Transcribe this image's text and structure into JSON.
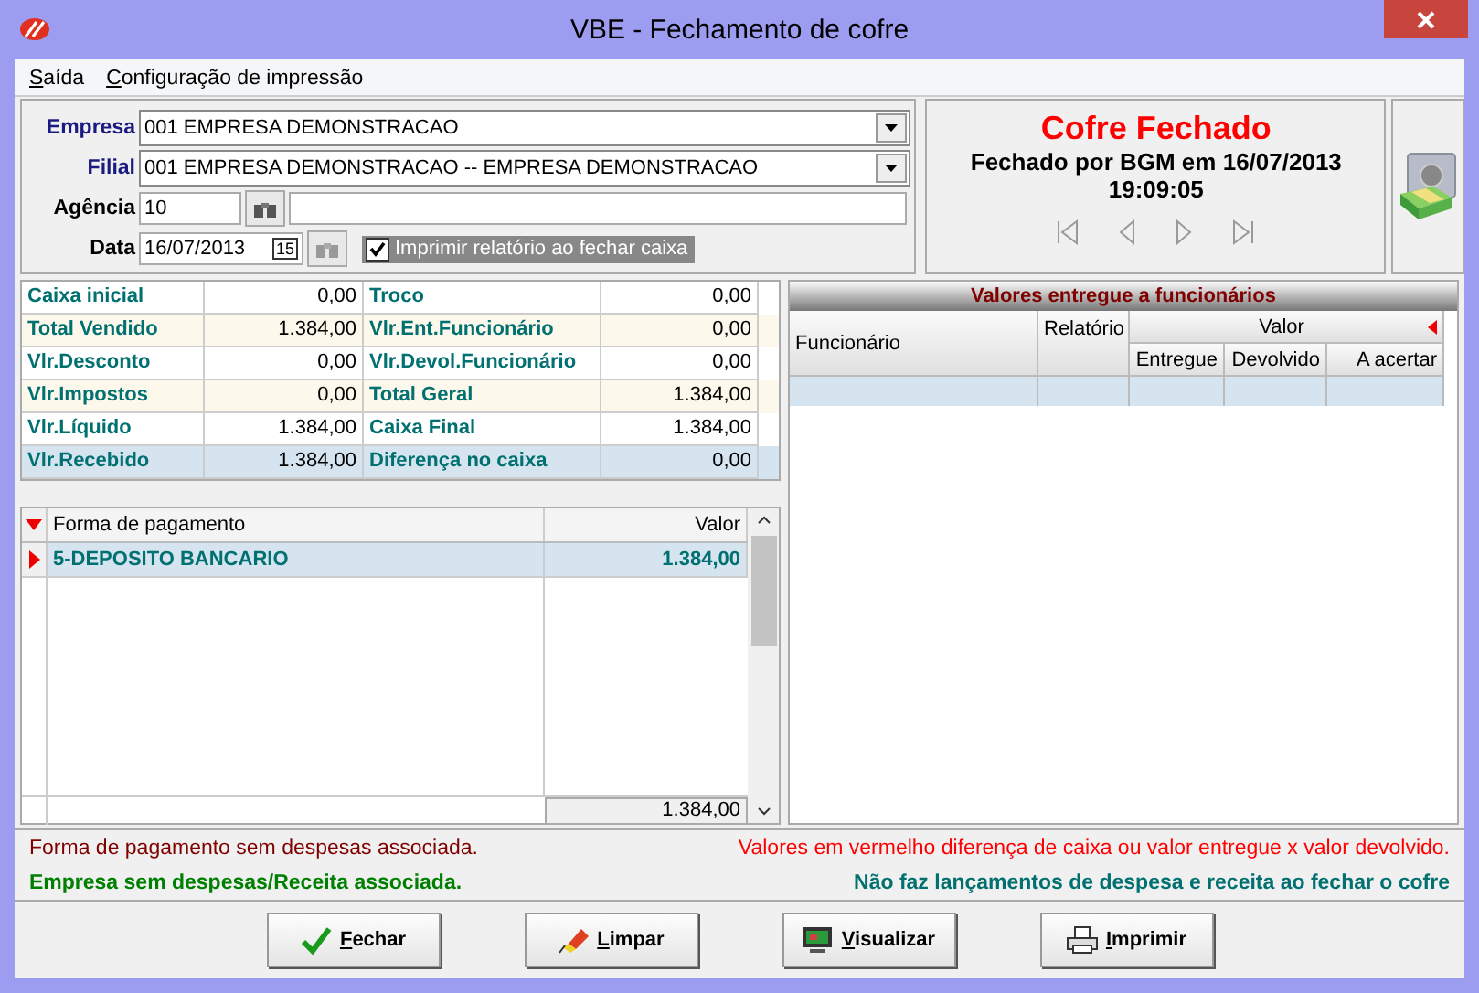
{
  "window": {
    "title": "VBE - Fechamento de cofre"
  },
  "menu": [
    {
      "label": "Saída"
    },
    {
      "label": "Configuração de impressão"
    }
  ],
  "form": {
    "empresa": {
      "label": "Empresa",
      "value": "001 EMPRESA DEMONSTRACAO"
    },
    "filial": {
      "label": "Filial",
      "value": "001 EMPRESA DEMONSTRACAO -- EMPRESA DEMONSTRACAO"
    },
    "agencia": {
      "label": "Agência",
      "value": "10"
    },
    "data": {
      "label": "Data",
      "value": "16/07/2013",
      "calendar": "15"
    },
    "print_option": {
      "label": "Imprimir relatório ao fechar caixa",
      "checked": true
    }
  },
  "status": {
    "title": "Cofre Fechado",
    "detail": "Fechado por BGM em 16/07/2013",
    "time": "19:09:05"
  },
  "summary": [
    {
      "label": "Caixa inicial",
      "value": "0,00",
      "label2": "Troco",
      "value2": "0,00",
      "selected": false
    },
    {
      "label": "Total Vendido",
      "value": "1.384,00",
      "label2": "Vlr.Ent.Funcionário",
      "value2": "0,00",
      "selected": false
    },
    {
      "label": "Vlr.Desconto",
      "value": "0,00",
      "label2": "Vlr.Devol.Funcionário",
      "value2": "0,00",
      "selected": false
    },
    {
      "label": "Vlr.Impostos",
      "value": "0,00",
      "label2": "Total Geral",
      "value2": "1.384,00",
      "selected": false
    },
    {
      "label": "Vlr.Líquido",
      "value": "1.384,00",
      "label2": "Caixa Final",
      "value2": "1.384,00",
      "selected": false
    },
    {
      "label": "Vlr.Recebido",
      "value": "1.384,00",
      "label2": "Diferença no caixa",
      "value2": "0,00",
      "selected": true
    }
  ],
  "payments": {
    "columns": [
      "Forma de pagamento",
      "Valor"
    ],
    "rows": [
      {
        "forma": "5-DEPOSITO BANCARIO",
        "valor": "1.384,00",
        "selected": true
      }
    ],
    "total": "1.384,00"
  },
  "employees": {
    "title": "Valores entregue a funcionários",
    "columns": [
      "Funcionário",
      "Relatório"
    ],
    "group": "Valor",
    "subcolumns": [
      "Entregue",
      "Devolvido",
      "A acertar"
    ]
  },
  "notes": [
    {
      "text": "Forma de pagamento sem despesas associada.",
      "kind": "warn"
    },
    {
      "text": "Valores em vermelho diferença de caixa ou valor entregue x valor devolvido.",
      "kind": "alert"
    },
    {
      "text": "Empresa sem despesas/Receita associada.",
      "kind": "ok"
    },
    {
      "text": "Não faz lançamentos de despesa e receita ao fechar o cofre",
      "kind": "info"
    }
  ],
  "buttons": [
    {
      "label": "Fechar",
      "kind": "confirm"
    },
    {
      "label": "Limpar",
      "kind": "clear"
    },
    {
      "label": "Visualizar",
      "kind": "preview"
    },
    {
      "label": "Imprimir",
      "kind": "print"
    }
  ]
}
